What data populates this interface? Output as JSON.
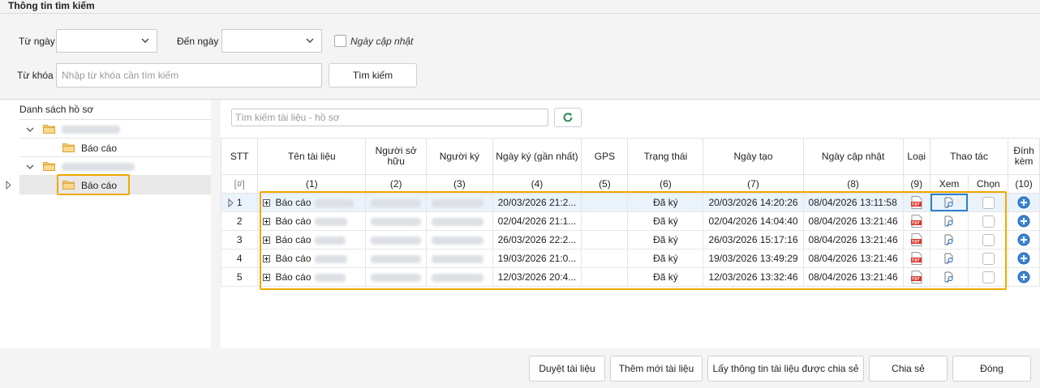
{
  "title": "Thông tin tìm kiếm",
  "filters": {
    "from_date_label": "Từ ngày",
    "to_date_label": "Đến ngày",
    "updated_date_label": "Ngày cập nhật",
    "keyword_label": "Từ khóa",
    "keyword_placeholder": "Nhập từ khóa cần tìm kiếm",
    "search_button": "Tìm kiếm"
  },
  "tree": {
    "header": "Danh sách hồ sơ",
    "items": [
      {
        "label": "Báo cáo"
      },
      {
        "label": "Báo cáo"
      }
    ]
  },
  "grid": {
    "search_placeholder": "Tìm kiếm tài liệu - hồ sơ",
    "headers": [
      "STT",
      "Tên tài liệu",
      "Người sở hữu",
      "Người ký",
      "Ngày ký (gần nhất)",
      "GPS",
      "Trạng thái",
      "Ngày tạo",
      "Ngày cập nhật",
      "Loại",
      "Thao tác",
      "Đính kèm"
    ],
    "subheaders": [
      "[#]",
      "(1)",
      "(2)",
      "(3)",
      "(4)",
      "(5)",
      "(6)",
      "(7)",
      "(8)",
      "(9)",
      "Xem",
      "Chọn",
      "(10)"
    ],
    "rows": [
      {
        "stt": "1",
        "name": "Báo cáo",
        "signed": "20/03/2026 21:2...",
        "status": "Đã ký",
        "created": "20/03/2026 14:20:26",
        "updated": "08/04/2026 13:11:58"
      },
      {
        "stt": "2",
        "name": "Báo cáo",
        "signed": "02/04/2026 21:1...",
        "status": "Đã ký",
        "created": "02/04/2026 14:04:40",
        "updated": "08/04/2026 13:21:46"
      },
      {
        "stt": "3",
        "name": "Báo cáo",
        "signed": "26/03/2026 22:2...",
        "status": "Đã ký",
        "created": "26/03/2026 15:17:16",
        "updated": "08/04/2026 13:21:46"
      },
      {
        "stt": "4",
        "name": "Báo cáo",
        "signed": "19/03/2026 21:0...",
        "status": "Đã ký",
        "created": "19/03/2026 13:49:29",
        "updated": "08/04/2026 13:21:46"
      },
      {
        "stt": "5",
        "name": "Báo cáo",
        "signed": "12/03/2026 20:4...",
        "status": "Đã ký",
        "created": "12/03/2026 13:32:46",
        "updated": "08/04/2026 13:21:46"
      }
    ]
  },
  "footer": {
    "review": "Duyệt tài liệu",
    "add_new": "Thêm mới tài liệu",
    "get_shared": "Lấy thông tin tài liệu được chia sẻ",
    "share": "Chia sẻ",
    "close": "Đóng"
  },
  "colors": {
    "highlight": "#f0a800",
    "accent_blue": "#2f80d1",
    "refresh_green": "#2e8b57",
    "pdf_red": "#d9332a"
  }
}
